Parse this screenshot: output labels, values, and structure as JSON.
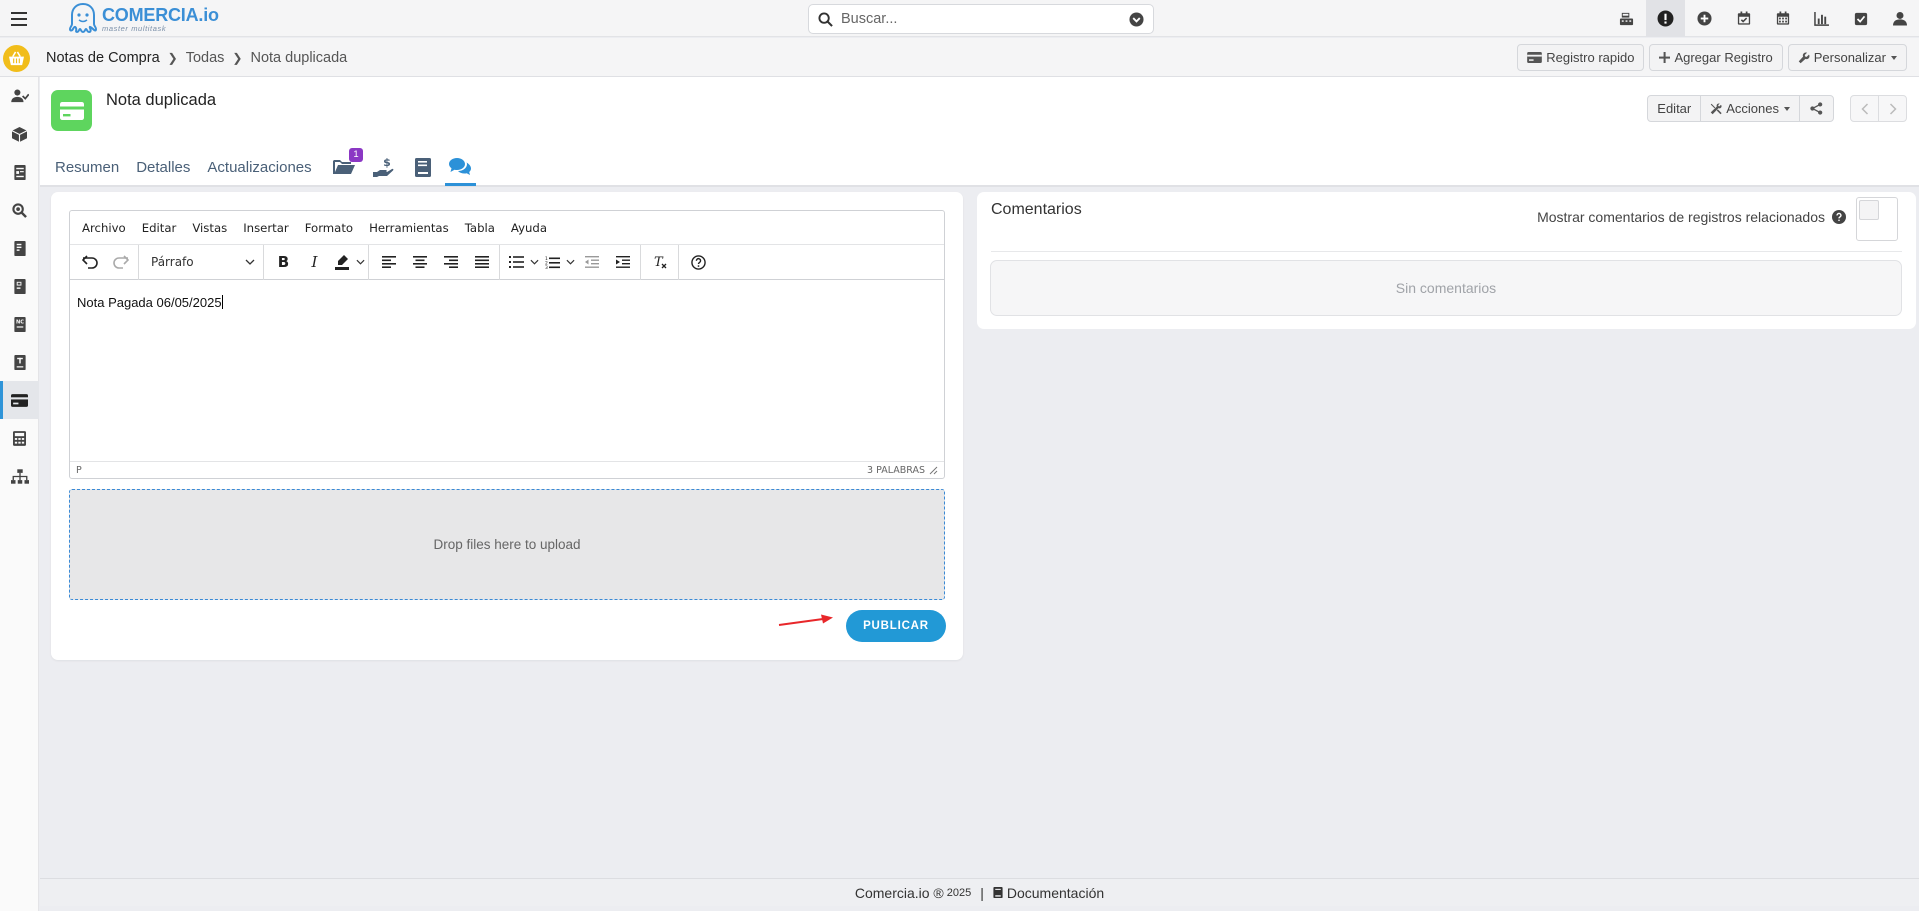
{
  "topbar": {
    "logo_title": "COMERCIA.io",
    "logo_subtitle": "master multitask",
    "search_placeholder": "Buscar...",
    "icons": [
      "cash-register-icon",
      "alert-icon",
      "plus-circle-icon",
      "calendar-check-icon",
      "calendar-icon",
      "bar-chart-icon",
      "checkbox-icon",
      "user-icon"
    ]
  },
  "breadcrumb": {
    "items": [
      "Notas de Compra",
      "Todas",
      "Nota duplicada"
    ]
  },
  "header_actions": {
    "quick": "Registro rapido",
    "add": "Agregar Registro",
    "customize": "Personalizar"
  },
  "sidebar": {
    "icons": [
      "users-icon",
      "box-icon",
      "id-card-icon",
      "search-doc-icon",
      "invoice-icon",
      "invoice-alt-icon",
      "nc-doc-icon",
      "document-icon",
      "credit-card-icon",
      "calculator-icon",
      "org-chart-icon"
    ],
    "active_index": 8
  },
  "record": {
    "title": "Nota duplicada",
    "edit_label": "Editar",
    "actions_label": "Acciones",
    "tabs": [
      "Resumen",
      "Detalles",
      "Actualizaciones"
    ],
    "folder_badge": "1"
  },
  "editor": {
    "menu": [
      "Archivo",
      "Editar",
      "Vistas",
      "Insertar",
      "Formato",
      "Herramientas",
      "Tabla",
      "Ayuda"
    ],
    "block_format": "Párrafo",
    "content": "Nota Pagada 06/05/2025",
    "status_path": "P",
    "word_count": "3 PALABRAS"
  },
  "dropzone": {
    "text": "Drop files here to upload"
  },
  "publish_label": "PUBLICAR",
  "comments": {
    "title": "Comentarios",
    "related_label": "Mostrar comentarios de registros relacionados",
    "empty_text": "Sin comentarios"
  },
  "footer": {
    "brand": "Comercia.io ®",
    "year": "2025",
    "docs": "Documentación"
  },
  "colors": {
    "accent": "#2299d6",
    "home": "#f1bd1a",
    "record_icon": "#5ed55e",
    "badge": "#8b37c4"
  }
}
